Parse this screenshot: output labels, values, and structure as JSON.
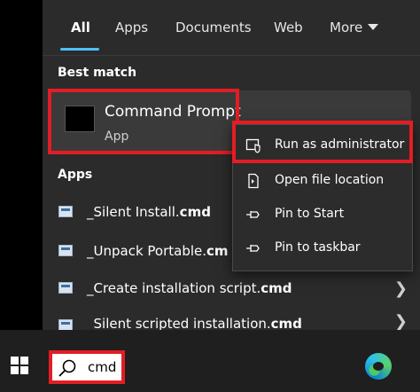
{
  "tabs": [
    {
      "label": "All",
      "active": true
    },
    {
      "label": "Apps"
    },
    {
      "label": "Documents"
    },
    {
      "label": "Web"
    },
    {
      "label": "More"
    }
  ],
  "best_match": {
    "section_label": "Best match",
    "title": "Command Prompt",
    "subtitle": "App"
  },
  "apps": {
    "section_label": "Apps",
    "items": [
      {
        "prefix": "_Silent Install.",
        "bold": "cmd",
        "has_chevron": false
      },
      {
        "prefix": "_Unpack Portable.",
        "bold": "cm",
        "has_chevron": false
      },
      {
        "prefix": "_Create installation script.",
        "bold": "cmd",
        "has_chevron": true
      },
      {
        "prefix": "_Silent scripted installation.",
        "bold": "cmd",
        "has_chevron": true
      }
    ]
  },
  "context_menu": {
    "items": [
      {
        "label": "Run as administrator",
        "icon": "shield-icon"
      },
      {
        "label": "Open file location",
        "icon": "file-icon"
      },
      {
        "label": "Pin to Start",
        "icon": "pin-icon"
      },
      {
        "label": "Pin to taskbar",
        "icon": "pin-icon"
      }
    ]
  },
  "taskbar": {
    "search_value": "cmd"
  },
  "colors": {
    "highlight": "#e31d24",
    "accent": "#4cc2ff"
  }
}
